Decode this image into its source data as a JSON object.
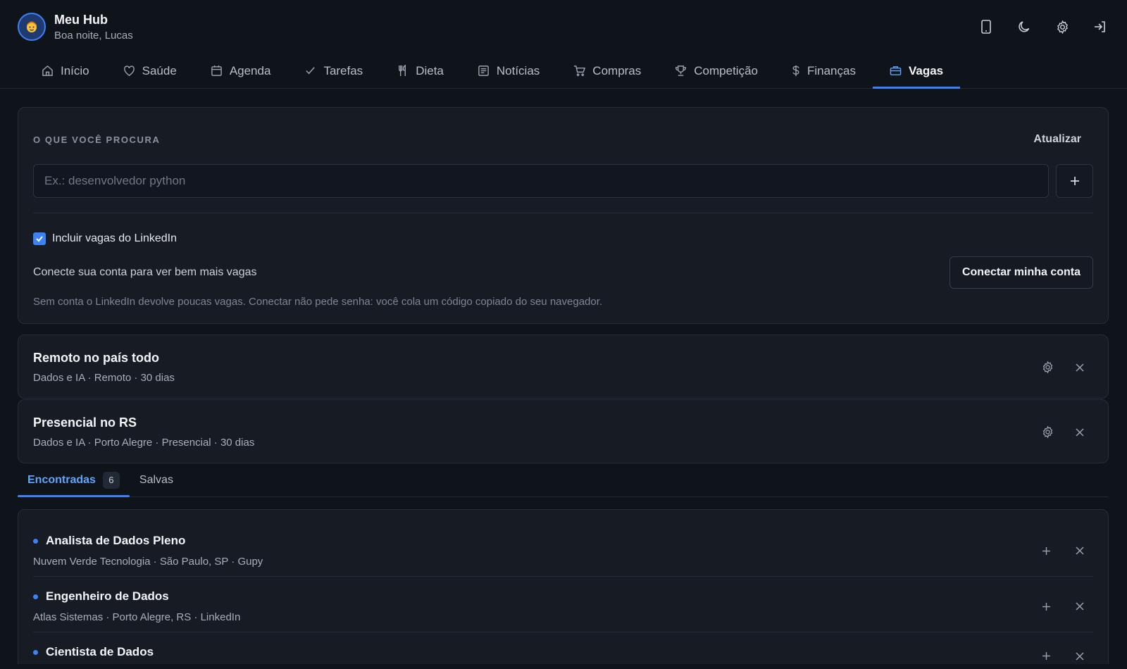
{
  "header": {
    "title": "Meu Hub",
    "greeting": "Boa noite, Lucas",
    "avatar_icon": "user-face-icon",
    "actions": [
      "phone-icon",
      "moon-icon",
      "gear-icon",
      "logout-icon"
    ]
  },
  "nav": {
    "items": [
      {
        "label": "Início",
        "icon": "home-icon"
      },
      {
        "label": "Saúde",
        "icon": "heart-icon"
      },
      {
        "label": "Agenda",
        "icon": "calendar-icon"
      },
      {
        "label": "Tarefas",
        "icon": "check-icon"
      },
      {
        "label": "Dieta",
        "icon": "utensils-icon"
      },
      {
        "label": "Notícias",
        "icon": "newspaper-icon"
      },
      {
        "label": "Compras",
        "icon": "cart-icon"
      },
      {
        "label": "Competição",
        "icon": "trophy-icon"
      },
      {
        "label": "Finanças",
        "icon": "dollar-icon"
      },
      {
        "label": "Vagas",
        "icon": "briefcase-icon"
      }
    ],
    "active": "Vagas"
  },
  "search": {
    "section_label": "O QUE VOCÊ PROCURA",
    "refresh_label": "Atualizar",
    "placeholder": "Ex.: desenvolvedor python",
    "value": "",
    "linkedin_label": "Incluir vagas do LinkedIn",
    "linkedin_checked": true,
    "connect_text": "Conecte sua conta para ver bem mais vagas",
    "connect_button": "Conectar minha conta",
    "hint": "Sem conta o LinkedIn devolve poucas vagas. Conectar não pede senha: você cola um código copiado do seu navegador."
  },
  "profiles": [
    {
      "title": "Remoto no país todo",
      "subtitle": "Dados e IA · Remoto · 30 dias"
    },
    {
      "title": "Presencial no RS",
      "subtitle": "Dados e IA · Porto Alegre · Presencial · 30 dias"
    }
  ],
  "tabs": {
    "found_label": "Encontradas",
    "found_count": "6",
    "saved_label": "Salvas"
  },
  "jobs": [
    {
      "title": "Analista de Dados Pleno",
      "subtitle": "Nuvem Verde Tecnologia · São Paulo, SP · Gupy"
    },
    {
      "title": "Engenheiro de Dados",
      "subtitle": "Atlas Sistemas · Porto Alegre, RS · LinkedIn"
    },
    {
      "title": "Cientista de Dados",
      "subtitle": ""
    }
  ],
  "colors": {
    "accent": "#3b82f6",
    "background": "#0f131a",
    "card": "#161b24"
  }
}
